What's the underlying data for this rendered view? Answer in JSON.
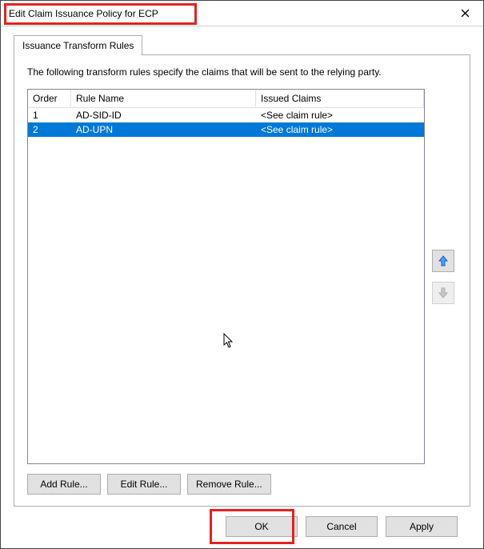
{
  "window": {
    "title": "Edit Claim Issuance Policy for ECP"
  },
  "tabs": [
    {
      "label": "Issuance Transform Rules",
      "active": true
    }
  ],
  "description": "The following transform rules specify the claims that will be sent to the relying party.",
  "columns": {
    "order": "Order",
    "rule_name": "Rule Name",
    "issued_claims": "Issued Claims"
  },
  "rules": [
    {
      "order": "1",
      "name": "AD-SID-ID",
      "issued": "<See claim rule>",
      "selected": false
    },
    {
      "order": "2",
      "name": "AD-UPN",
      "issued": "<See claim rule>",
      "selected": true
    }
  ],
  "side": {
    "up_enabled": true,
    "down_enabled": false
  },
  "rule_buttons": {
    "add": "Add Rule...",
    "edit": "Edit Rule...",
    "remove": "Remove Rule..."
  },
  "dialog_buttons": {
    "ok": "OK",
    "cancel": "Cancel",
    "apply": "Apply"
  },
  "icons": {
    "close": "close-icon",
    "up": "arrow-up-icon",
    "down": "arrow-down-icon"
  },
  "colors": {
    "selection": "#0078D7",
    "highlight_border": "#E82020"
  }
}
